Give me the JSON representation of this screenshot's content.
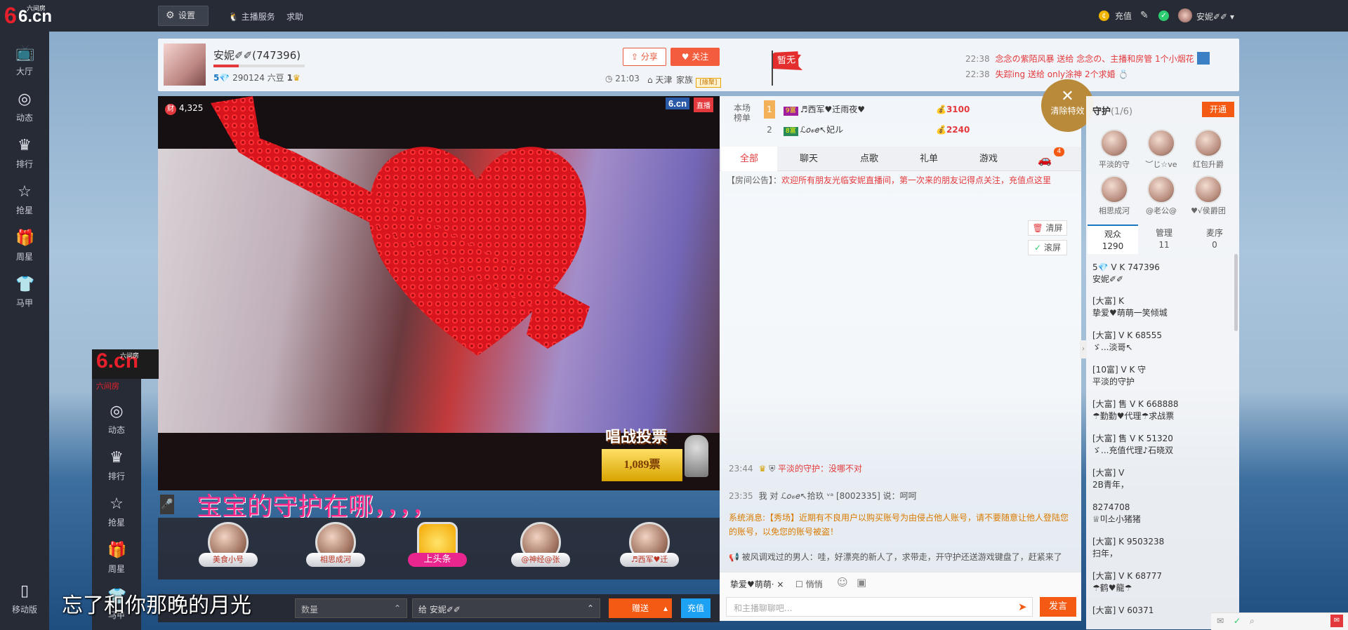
{
  "app": {
    "brand_mark": "6.cn",
    "brand_name": "六间房"
  },
  "topbar": {
    "settings_label": "设置",
    "anchor_service": "主播服务",
    "help": "求助",
    "recharge": "充值",
    "username": "安妮✐✐"
  },
  "nav": [
    {
      "label": "大厅",
      "icon": "tv-icon"
    },
    {
      "label": "动态",
      "icon": "compass-icon"
    },
    {
      "label": "排行",
      "icon": "crown-icon"
    },
    {
      "label": "抢星",
      "icon": "star-icon"
    },
    {
      "label": "周星",
      "icon": "gift-icon"
    },
    {
      "label": "马甲",
      "icon": "shirt-icon"
    }
  ],
  "mobile_label": "移动版",
  "anchor": {
    "name": "安妮✐✐(747396)",
    "level": "5",
    "beans": "290124 六豆",
    "fans": "1",
    "share": "分享",
    "follow": "关注",
    "start_time": "21:03",
    "hometown": "天津",
    "family": "家族",
    "family_badge": "[緣聚]"
  },
  "flag_text": "暂无",
  "gift_feed": [
    {
      "time": "22:38",
      "text": "念念の紫陌风暴 送给 念念の、主播和房管 1个小烟花"
    },
    {
      "time": "22:38",
      "text": "失踪ing 送给 only涂神 2个求婚"
    }
  ],
  "video": {
    "wealth": "4,325",
    "wealth_badge": "财",
    "logo": "6.cn",
    "live": "直播",
    "vote_title": "唱战投票",
    "vote_count": "1,089票",
    "scroll_message": "宝宝的守护在哪，，，，",
    "lyric": "忘了和你那晚的月光"
  },
  "guard_seats": [
    {
      "name": "美食小号"
    },
    {
      "name": "相思成河"
    },
    {
      "name": "上头条"
    },
    {
      "name": "@神经@张"
    },
    {
      "name": "♬西军♥迁"
    }
  ],
  "giftbar": {
    "qty_placeholder": "数量",
    "to_label": "给  安妮✐✐",
    "send": "赠送",
    "recharge": "充值"
  },
  "rank": {
    "label": "本场榜单",
    "rows": [
      {
        "n": "1",
        "lv": "9富",
        "name": "♬西军♥迁雨夜♥",
        "score": "3100"
      },
      {
        "n": "2",
        "lv": "8富",
        "name": "ℒ𝑜𝓋𝑒↖妃ル",
        "score": "2240"
      }
    ]
  },
  "clear_fx": "清除特效",
  "chat_tabs": [
    "全部",
    "聊天",
    "点歌",
    "礼单",
    "游戏"
  ],
  "car_count": "4",
  "announcement_label": "【房间公告】：",
  "announcement_text": "欢迎所有朋友光临安妮直播间，第一次来的朋友记得点关注，充值点这里",
  "clear_chat": "清屏",
  "scroll_chat": "滚屏",
  "chat": [
    {
      "time": "23:44",
      "user": "平淡的守护",
      "text": "：没哪不对"
    },
    {
      "time": "23:35",
      "user": "我 对 ℒ𝑜𝓋𝑒↖拾玖 ᵛᵃ [8002335] 说：",
      "text": "呵呵"
    },
    {
      "label": "系统消息:",
      "text": "【秀场】近期有不良用户以购买账号为由侵占他人账号，请不要随意让他人登陆您的账号，以免您的账号被盗！"
    },
    {
      "text": "被风调戏过的男人：哇，好漂亮的新人了，求带走，开守护还送游戏键盘了，赶紧来了"
    }
  ],
  "chat_footer": {
    "target": "挚爱♥萌萌·",
    "whisper": "悄悄",
    "placeholder": "和主播聊聊吧...",
    "send": "发言"
  },
  "guard_panel": {
    "title": "守护",
    "count": "(1/6)",
    "open": "开通",
    "members": [
      "平淡的守",
      "︶じ☆ve",
      "红包升爵",
      "相思成河",
      "@老公@",
      "♥√侯爵团"
    ]
  },
  "user_tabs": [
    {
      "label": "观众",
      "count": "1290"
    },
    {
      "label": "管理",
      "count": "11"
    },
    {
      "label": "麦序",
      "count": "0"
    }
  ],
  "audience": [
    {
      "badges": "5💎 V K 747396",
      "name": "安妮✐✐"
    },
    {
      "badges": "[大富] K",
      "name": "挚爱♥萌萌一笑倾城"
    },
    {
      "badges": "[大富] V K 68555",
      "name": "ゞ...淡哥↖"
    },
    {
      "badges": "[10富] V K 守",
      "name": "平淡的守护"
    },
    {
      "badges": "[大富] 售 V K 668888",
      "name": "☂勤勤♥代理☂求战票"
    },
    {
      "badges": "[大富] 售 V K 51320",
      "name": "ゞ...充值代理♪石晓双"
    },
    {
      "badges": "[大富] V",
      "name": "2B青年，"
    },
    {
      "badges": "8274708",
      "name": "♕미소小猪猪"
    },
    {
      "badges": "[大富] K 9503238",
      "name": "扫年，"
    },
    {
      "badges": "[大富] V K 68777",
      "name": "☂鹤♥龍☂"
    },
    {
      "badges": "[大富] V 60371",
      "name": ""
    }
  ]
}
